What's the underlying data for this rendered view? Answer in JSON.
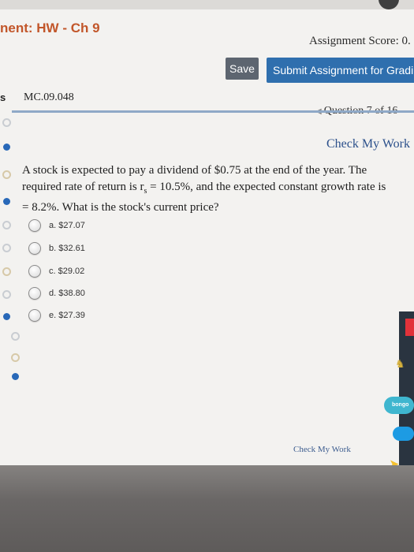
{
  "header": {
    "title": "nent: HW - Ch 9",
    "score": "Assignment Score: 0.",
    "save_label": "Save",
    "submit_label": "Submit Assignment for Gradi"
  },
  "sidebar": {
    "label": "s"
  },
  "question": {
    "id": "MC.09.048",
    "nav": "Question 7 of 16",
    "check_my_work": "Check My Work",
    "text_line1": "A stock is expected to pay a dividend of $0.75 at the end of the year. The",
    "text_line2_pre": "required rate of return is r",
    "text_sub": "s",
    "text_line2_post": " = 10.5%, and the expected constant growth rate is",
    "text_line3": "= 8.2%. What is the stock's current price?",
    "choices": [
      {
        "label": "a. $27.07"
      },
      {
        "label": "b. $32.61"
      },
      {
        "label": "c. $29.02"
      },
      {
        "label": "d. $38.80"
      },
      {
        "label": "e. $27.39"
      }
    ],
    "bottom_check": "Check My Work"
  },
  "dock": {
    "bongo_label": "bongo"
  }
}
